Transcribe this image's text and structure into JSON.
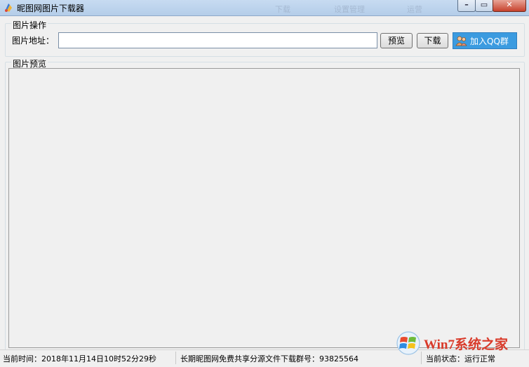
{
  "window": {
    "title": "昵图网图片下载器",
    "ghost_items": [
      "下载",
      "设置管理",
      "运营"
    ]
  },
  "image_ops": {
    "group_label": "图片操作",
    "address_label": "图片地址：",
    "address_value": "",
    "preview_button": "预览",
    "download_button": "下载",
    "qq_button": "加入QQ群"
  },
  "preview_area": {
    "group_label": "图片预览"
  },
  "status": {
    "time": "当前时间：2018年11月14日10时52分29秒",
    "group_info": "长期昵图网免费共享分源文件下载群号：93825564",
    "state": "当前状态：运行正常"
  },
  "watermark": {
    "text": "Win7系统之家"
  },
  "colors": {
    "titlebar": "#c7dbf1",
    "qq_button": "#3b9be0",
    "close_button": "#c7412c"
  },
  "icons": [
    "app-icon",
    "qq-group-icon",
    "windows-logo-icon"
  ]
}
